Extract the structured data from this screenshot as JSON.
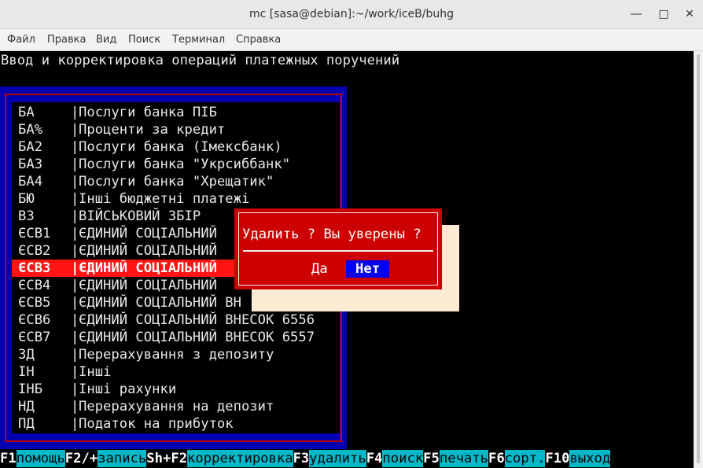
{
  "window": {
    "title": "mc [sasa@debian]:~/work/iceB/buhg",
    "buttons": {
      "minimize": "―",
      "maximize": "□",
      "close": "✕"
    }
  },
  "menubar": [
    "Файл",
    "Правка",
    "Вид",
    "Поиск",
    "Терминал",
    "Справка"
  ],
  "heading": "Ввод и корректировка операций платежных поручений",
  "list": {
    "separator": "|",
    "selected_index": 9,
    "rows": [
      {
        "code": "БА",
        "desc": "Послуги банка ПІБ"
      },
      {
        "code": "БА%",
        "desc": "Проценти за кредит"
      },
      {
        "code": "БА2",
        "desc": "Послуги банка (Імексбанк)"
      },
      {
        "code": "БА3",
        "desc": "Послуги банка \"Укрсиббанк\""
      },
      {
        "code": "БА4",
        "desc": "Послуги банка \"Хрещатик\""
      },
      {
        "code": "БЮ",
        "desc": "Інші бюджетні платежі"
      },
      {
        "code": "ВЗ",
        "desc": "ВІЙСЬКОВИЙ ЗБІР"
      },
      {
        "code": "ЄСВ1",
        "desc": "ЄДИНИЙ СОЦІАЛЬНИЙ"
      },
      {
        "code": "ЄСВ2",
        "desc": "ЄДИНИЙ СОЦІАЛЬНИЙ"
      },
      {
        "code": "ЄСВ3",
        "desc": "ЄДИНИЙ СОЦІАЛЬНИЙ"
      },
      {
        "code": "ЄСВ4",
        "desc": "ЄДИНИЙ СОЦІАЛЬНИЙ"
      },
      {
        "code": "ЄСВ5",
        "desc": "ЄДИНИЙ СОЦІАЛЬНИЙ ВН"
      },
      {
        "code": "ЄСВ6",
        "desc": "ЄДИНИЙ СОЦІАЛЬНИЙ ВНЕСОК 6556"
      },
      {
        "code": "ЄСВ7",
        "desc": "ЄДИНИЙ СОЦІАЛЬНИЙ ВНЕСОК 6557"
      },
      {
        "code": "ЗД",
        "desc": "Перерахування з депозиту"
      },
      {
        "code": "ІН",
        "desc": "Інші"
      },
      {
        "code": "ІНБ",
        "desc": "Інші рахунки"
      },
      {
        "code": "НД",
        "desc": "Перерахування на депозит"
      },
      {
        "code": "ПД",
        "desc": "Податок на прибуток"
      }
    ]
  },
  "dialog": {
    "message": "Удалить ? Вы уверены ?",
    "yes_label": "Да",
    "no_label": "Нет"
  },
  "function_keys": [
    {
      "key": "F1",
      "label": "помощь"
    },
    {
      "key": "F2/+",
      "label": "запись"
    },
    {
      "key": "Sh+F2",
      "label": "корректировка"
    },
    {
      "key": "F3",
      "label": "удалить"
    },
    {
      "key": "F4",
      "label": "поиск"
    },
    {
      "key": "F5",
      "label": "печать"
    },
    {
      "key": "F6",
      "label": "сорт."
    },
    {
      "key": "F10",
      "label": "выход"
    }
  ],
  "colors": {
    "panel_blue": "#0000b0",
    "frame_red": "#c00000",
    "selection_red": "#ff1414",
    "dialog_red": "#cc0000",
    "button_blue": "#0000ee",
    "fkey_cyan": "#00b8c8",
    "shadow_cream": "#fdebd3"
  }
}
